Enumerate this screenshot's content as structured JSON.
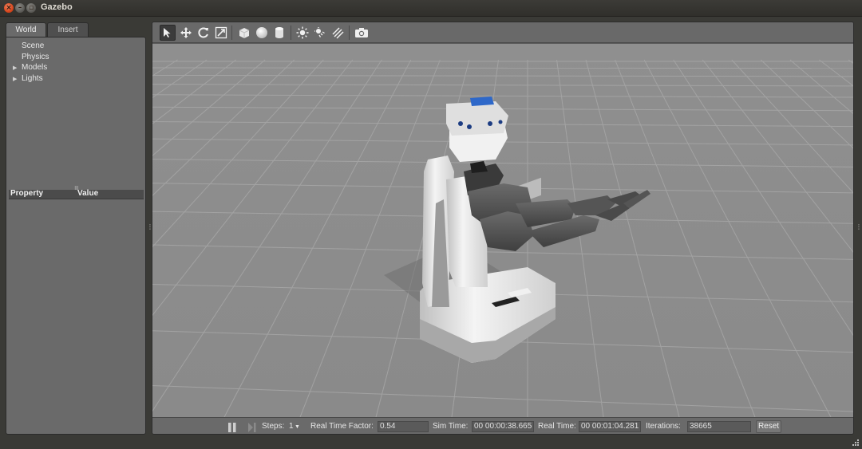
{
  "window": {
    "title": "Gazebo"
  },
  "left_panel": {
    "tabs": [
      {
        "label": "World",
        "active": true
      },
      {
        "label": "Insert",
        "active": false
      }
    ],
    "tree": [
      {
        "label": "Scene",
        "expandable": false
      },
      {
        "label": "Physics",
        "expandable": false
      },
      {
        "label": "Models",
        "expandable": true
      },
      {
        "label": "Lights",
        "expandable": true
      }
    ],
    "property_header": {
      "property": "Property",
      "value": "Value"
    }
  },
  "toolbar": {
    "tools": [
      "select-mode-icon",
      "translate-mode-icon",
      "rotate-mode-icon",
      "scale-mode-icon",
      "box-shape-icon",
      "sphere-shape-icon",
      "cylinder-shape-icon",
      "point-light-icon",
      "spot-light-icon",
      "directional-light-icon",
      "screenshot-icon"
    ]
  },
  "bottom_bar": {
    "steps_label": "Steps:",
    "steps_value": "1",
    "rtf_label": "Real Time Factor:",
    "rtf_value": "0.54",
    "sim_time_label": "Sim Time:",
    "sim_time_value": "00 00:00:38.665",
    "real_time_label": "Real Time:",
    "real_time_value": "00 00:01:04.281",
    "iterations_label": "Iterations:",
    "iterations_value": "38665",
    "reset_label": "Reset"
  },
  "colors": {
    "viewport_bg": "#8d8d8d",
    "grid_line": "#a9a9a9",
    "panel_bg": "#6a6a6a",
    "window_bg": "#3a3a36"
  }
}
